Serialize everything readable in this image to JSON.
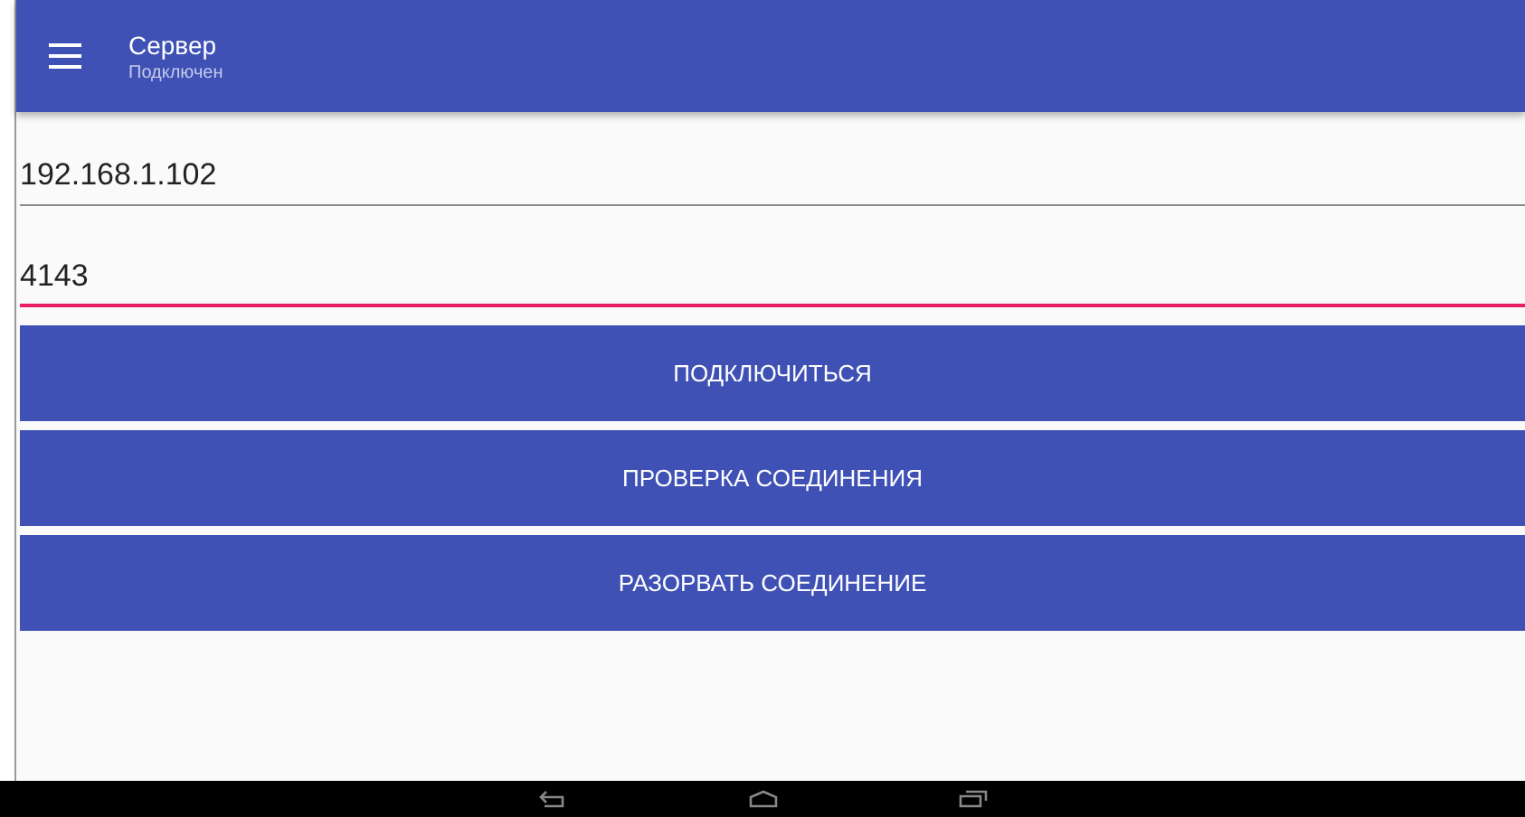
{
  "app_bar": {
    "title": "Сервер",
    "subtitle": "Подключен"
  },
  "fields": [
    {
      "value": "192.168.1.102",
      "focused": false
    },
    {
      "value": "4143",
      "focused": true
    }
  ],
  "buttons": [
    "ПОДКЛЮЧИТЬСЯ",
    "ПРОВЕРКА СОЕДИНЕНИЯ",
    "РАЗОРВАТЬ СОЕДИНЕНИЕ"
  ]
}
